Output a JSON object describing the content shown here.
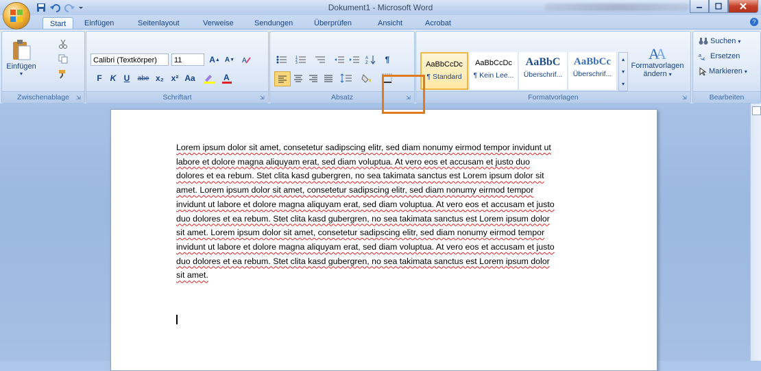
{
  "window": {
    "title": "Dokument1 - Microsoft Word",
    "office_button": "office-button",
    "quick_access": [
      "save-icon",
      "undo-icon",
      "redo-icon",
      "customize-icon"
    ]
  },
  "tabs": [
    "Start",
    "Einfügen",
    "Seitenlayout",
    "Verweise",
    "Sendungen",
    "Überprüfen",
    "Ansicht",
    "Acrobat"
  ],
  "ribbon": {
    "clipboard": {
      "paste_label": "Einfügen",
      "group_label": "Zwischenablage"
    },
    "font": {
      "font_name": "Calibri (Textkörper)",
      "font_size": "11",
      "group_label": "Schriftart",
      "bold": "F",
      "italic": "K",
      "underline": "U",
      "strike": "abe",
      "sub": "x₂",
      "sup": "x²",
      "case": "Aa"
    },
    "paragraph": {
      "group_label": "Absatz"
    },
    "styles": {
      "group_label": "Formatvorlagen",
      "items": [
        {
          "sample": "AaBbCcDc",
          "name": "¶ Standard"
        },
        {
          "sample": "AaBbCcDc",
          "name": "¶ Kein Lee..."
        },
        {
          "sample": "AaBbC",
          "name": "Überschrif..."
        },
        {
          "sample": "AaBbCc",
          "name": "Überschrif..."
        }
      ],
      "change_label": "Formatvorlagen",
      "change_label2": "ändern"
    },
    "editing": {
      "group_label": "Bearbeiten",
      "find": "Suchen",
      "replace": "Ersetzen",
      "select": "Markieren"
    }
  },
  "document": {
    "lines": [
      "Lorem ipsum dolor sit amet, consetetur sadipscing elitr, sed diam nonumy eirmod tempor invidunt ut",
      "labore et dolore magna aliquyam erat, sed diam voluptua. At vero eos et accusam et justo duo",
      "dolores et ea rebum. Stet clita kasd gubergren, no sea takimata sanctus est Lorem ipsum dolor sit",
      "amet. Lorem ipsum dolor sit amet, consetetur sadipscing elitr, sed diam nonumy eirmod tempor",
      "invidunt ut labore et dolore magna aliquyam erat, sed diam voluptua. At vero eos et accusam et justo",
      "duo dolores et ea rebum. Stet clita kasd gubergren, no sea takimata sanctus est Lorem ipsum dolor",
      "sit amet. Lorem ipsum dolor sit amet, consetetur sadipscing elitr, sed diam nonumy eirmod tempor",
      "invidunt ut labore et dolore magna aliquyam erat, sed diam voluptua. At vero eos et accusam et justo",
      "duo dolores et ea rebum. Stet clita kasd gubergren, no sea takimata sanctus est Lorem ipsum dolor",
      "sit amet."
    ]
  },
  "colors": {
    "highlight_box": "#e07a1f",
    "ribbon_text": "#15428b"
  }
}
